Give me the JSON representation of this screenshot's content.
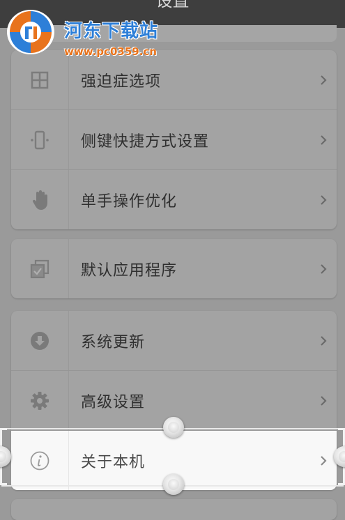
{
  "header": {
    "title": "设置"
  },
  "watermark": {
    "name": "河东下载站",
    "url": "www.pc0359.cn"
  },
  "groups": [
    {
      "items": [
        {
          "label": "强迫症选项",
          "icon": "grid-icon"
        },
        {
          "label": "侧键快捷方式设置",
          "icon": "phone-side-keys-icon"
        },
        {
          "label": "单手操作优化",
          "icon": "hand-icon"
        }
      ]
    },
    {
      "items": [
        {
          "label": "默认应用程序",
          "icon": "default-apps-icon"
        }
      ]
    },
    {
      "items": [
        {
          "label": "系统更新",
          "icon": "download-circle-icon"
        },
        {
          "label": "高级设置",
          "icon": "gear-icon"
        },
        {
          "label": "关于本机",
          "icon": "info-icon",
          "selected": true
        }
      ]
    }
  ],
  "colors": {
    "overlay_gray": "#9a9a9a",
    "selected_row": "#f8f8f8",
    "watermark_blue": "#2d7fd8",
    "watermark_orange": "#e8731c"
  }
}
